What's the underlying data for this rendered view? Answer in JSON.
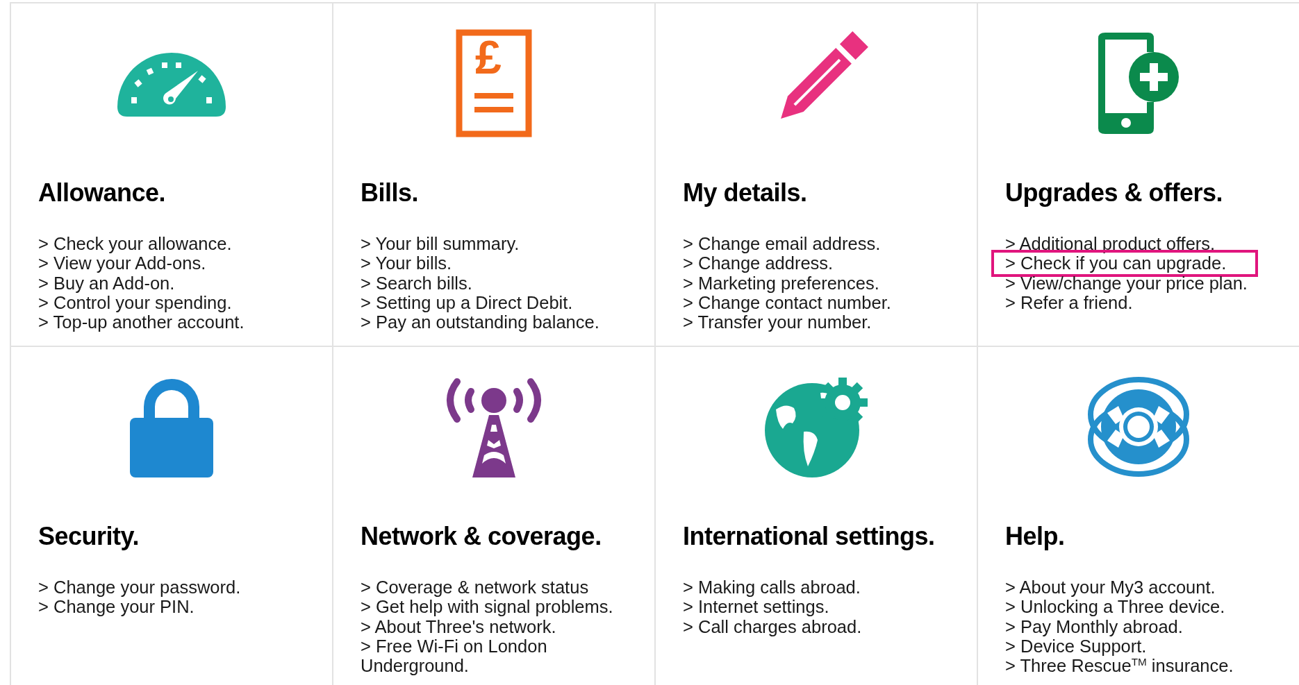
{
  "cards": [
    {
      "kind": "gauge",
      "color": "#1fb39c",
      "title": "Allowance.",
      "links": [
        {
          "text": "> Check your allowance.",
          "highlighted": false
        },
        {
          "text": "> View your Add-ons.",
          "highlighted": false
        },
        {
          "text": "> Buy an Add-on.",
          "highlighted": false
        },
        {
          "text": "> Control your spending.",
          "highlighted": false
        },
        {
          "text": "> Top-up another account.",
          "highlighted": false
        }
      ]
    },
    {
      "kind": "bill",
      "color": "#f26a1b",
      "icon_glyph": "£",
      "title": "Bills.",
      "links": [
        {
          "text": "> Your bill summary.",
          "highlighted": false
        },
        {
          "text": "> Your bills.",
          "highlighted": false
        },
        {
          "text": "> Search bills.",
          "highlighted": false
        },
        {
          "text": "> Setting up a Direct Debit.",
          "highlighted": false
        },
        {
          "text": "> Pay an outstanding balance.",
          "highlighted": false
        }
      ]
    },
    {
      "kind": "pencil",
      "color": "#e8317f",
      "title": "My details.",
      "links": [
        {
          "text": "> Change email address.",
          "highlighted": false
        },
        {
          "text": "> Change address.",
          "highlighted": false
        },
        {
          "text": "> Marketing preferences.",
          "highlighted": false
        },
        {
          "text": "> Change contact number.",
          "highlighted": false
        },
        {
          "text": "> Transfer your number.",
          "highlighted": false
        }
      ]
    },
    {
      "kind": "phone",
      "color": "#0b8a4c",
      "title": "Upgrades & offers.",
      "links": [
        {
          "text": "> Additional product offers.",
          "highlighted": false
        },
        {
          "text": "> Check if you can upgrade.",
          "highlighted": true
        },
        {
          "text": "> View/change your price plan.",
          "highlighted": false
        },
        {
          "text": "> Refer a friend.",
          "highlighted": false
        }
      ]
    },
    {
      "kind": "lock",
      "color": "#1e88d0",
      "title": "Security.",
      "links": [
        {
          "text": "> Change your password.",
          "highlighted": false
        },
        {
          "text": "> Change your PIN.",
          "highlighted": false
        }
      ]
    },
    {
      "kind": "tower",
      "color": "#7c398b",
      "title": "Network & coverage.",
      "links": [
        {
          "text": "> Coverage & network status",
          "highlighted": false
        },
        {
          "text": "> Get help with signal problems.",
          "highlighted": false
        },
        {
          "text": "> About Three's network.",
          "highlighted": false
        },
        {
          "text": "> Free Wi-Fi on London Underground.",
          "highlighted": false
        }
      ]
    },
    {
      "kind": "globe",
      "color": "#1aa891",
      "title": "International settings.",
      "links": [
        {
          "text": "> Making calls abroad.",
          "highlighted": false
        },
        {
          "text": "> Internet settings.",
          "highlighted": false
        },
        {
          "text": "> Call charges abroad.",
          "highlighted": false
        }
      ]
    },
    {
      "kind": "lifebuoy",
      "color": "#2590cc",
      "title": "Help.",
      "links": [
        {
          "text": "> About your My3 account.",
          "highlighted": false
        },
        {
          "text": "> Unlocking a Three device.",
          "highlighted": false
        },
        {
          "text": "> Pay Monthly abroad.",
          "highlighted": false
        },
        {
          "text": "> Device Support.",
          "highlighted": false
        },
        {
          "text": "> Three Rescue$^{TM}$ insurance.",
          "highlighted": false
        }
      ]
    }
  ]
}
